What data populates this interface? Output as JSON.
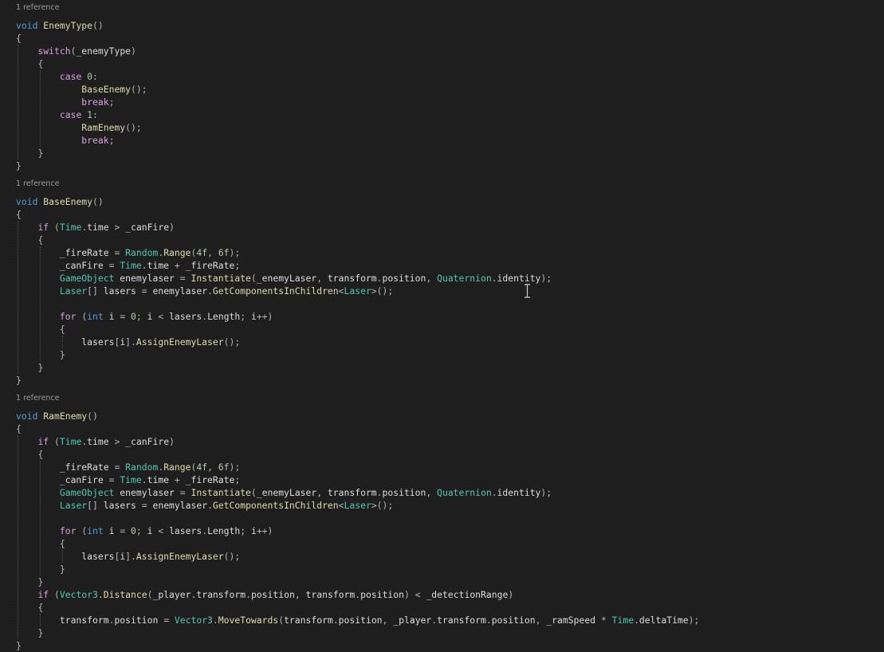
{
  "code_lens": [
    {
      "text": "1 reference",
      "line": 0
    },
    {
      "text": "1 reference",
      "line": 13
    },
    {
      "text": "1 reference",
      "line": 30
    }
  ],
  "lines": [
    [
      [
        "kw",
        "void"
      ],
      [
        "id",
        " "
      ],
      [
        "fn",
        "EnemyType"
      ],
      [
        "pn",
        "()"
      ]
    ],
    [
      [
        "pn",
        "{"
      ]
    ],
    [
      [
        "id",
        "    "
      ],
      [
        "ctl",
        "switch"
      ],
      [
        "pn",
        "("
      ],
      [
        "id",
        "_enemyType"
      ],
      [
        "pn",
        ")"
      ]
    ],
    [
      [
        "id",
        "    "
      ],
      [
        "pn",
        "{"
      ]
    ],
    [
      [
        "id",
        "        "
      ],
      [
        "ctl",
        "case"
      ],
      [
        "id",
        " "
      ],
      [
        "num",
        "0"
      ],
      [
        "pn",
        ":"
      ]
    ],
    [
      [
        "id",
        "            "
      ],
      [
        "fn",
        "BaseEnemy"
      ],
      [
        "pn",
        "();"
      ]
    ],
    [
      [
        "id",
        "            "
      ],
      [
        "ctl",
        "break"
      ],
      [
        "pn",
        ";"
      ]
    ],
    [
      [
        "id",
        "        "
      ],
      [
        "ctl",
        "case"
      ],
      [
        "id",
        " "
      ],
      [
        "num",
        "1"
      ],
      [
        "pn",
        ":"
      ]
    ],
    [
      [
        "id",
        "            "
      ],
      [
        "fn",
        "RamEnemy"
      ],
      [
        "pn",
        "();"
      ]
    ],
    [
      [
        "id",
        "            "
      ],
      [
        "ctl",
        "break"
      ],
      [
        "pn",
        ";"
      ]
    ],
    [
      [
        "id",
        "    "
      ],
      [
        "pn",
        "}"
      ]
    ],
    [
      [
        "pn",
        "}"
      ]
    ],
    [],
    [
      [
        "kw",
        "void"
      ],
      [
        "id",
        " "
      ],
      [
        "fn",
        "BaseEnemy"
      ],
      [
        "pn",
        "()"
      ]
    ],
    [
      [
        "pn",
        "{"
      ]
    ],
    [
      [
        "id",
        "    "
      ],
      [
        "ctl",
        "if"
      ],
      [
        "id",
        " "
      ],
      [
        "pn",
        "("
      ],
      [
        "ty",
        "Time"
      ],
      [
        "pn",
        "."
      ],
      [
        "id",
        "time "
      ],
      [
        "pn",
        "> "
      ],
      [
        "id",
        "_canFire"
      ],
      [
        "pn",
        ")"
      ]
    ],
    [
      [
        "id",
        "    "
      ],
      [
        "pn",
        "{"
      ]
    ],
    [
      [
        "id",
        "        _fireRate "
      ],
      [
        "pn",
        "= "
      ],
      [
        "ty",
        "Random"
      ],
      [
        "pn",
        "."
      ],
      [
        "fn",
        "Range"
      ],
      [
        "pn",
        "("
      ],
      [
        "num",
        "4f"
      ],
      [
        "pn",
        ", "
      ],
      [
        "num",
        "6f"
      ],
      [
        "pn",
        ");"
      ]
    ],
    [
      [
        "id",
        "        _canFire "
      ],
      [
        "pn",
        "= "
      ],
      [
        "ty",
        "Time"
      ],
      [
        "pn",
        "."
      ],
      [
        "id",
        "time "
      ],
      [
        "pn",
        "+ "
      ],
      [
        "id",
        "_fireRate"
      ],
      [
        "pn",
        ";"
      ]
    ],
    [
      [
        "id",
        "        "
      ],
      [
        "ty",
        "GameObject"
      ],
      [
        "id",
        " enemylaser "
      ],
      [
        "pn",
        "= "
      ],
      [
        "fn",
        "Instantiate"
      ],
      [
        "pn",
        "("
      ],
      [
        "id",
        "_enemyLaser"
      ],
      [
        "pn",
        ", "
      ],
      [
        "id",
        "transform"
      ],
      [
        "pn",
        "."
      ],
      [
        "id",
        "position"
      ],
      [
        "pn",
        ", "
      ],
      [
        "ty",
        "Quaternion"
      ],
      [
        "pn",
        "."
      ],
      [
        "id",
        "identity"
      ],
      [
        "pn",
        ");"
      ]
    ],
    [
      [
        "id",
        "        "
      ],
      [
        "ty",
        "Laser"
      ],
      [
        "pn",
        "[] "
      ],
      [
        "id",
        "lasers "
      ],
      [
        "pn",
        "= "
      ],
      [
        "id",
        "enemylaser"
      ],
      [
        "pn",
        "."
      ],
      [
        "fn",
        "GetComponentsInChildren"
      ],
      [
        "pn",
        "<"
      ],
      [
        "ty",
        "Laser"
      ],
      [
        "pn",
        ">();"
      ]
    ],
    [],
    [
      [
        "id",
        "        "
      ],
      [
        "ctl",
        "for"
      ],
      [
        "id",
        " "
      ],
      [
        "pn",
        "("
      ],
      [
        "kw",
        "int"
      ],
      [
        "id",
        " i "
      ],
      [
        "pn",
        "= "
      ],
      [
        "num",
        "0"
      ],
      [
        "pn",
        "; "
      ],
      [
        "id",
        "i "
      ],
      [
        "pn",
        "< "
      ],
      [
        "id",
        "lasers"
      ],
      [
        "pn",
        "."
      ],
      [
        "id",
        "Length"
      ],
      [
        "pn",
        "; "
      ],
      [
        "id",
        "i"
      ],
      [
        "pn",
        "++)"
      ]
    ],
    [
      [
        "id",
        "        "
      ],
      [
        "pn",
        "{"
      ]
    ],
    [
      [
        "id",
        "            lasers"
      ],
      [
        "pn",
        "["
      ],
      [
        "id",
        "i"
      ],
      [
        "pn",
        "]."
      ],
      [
        "fn",
        "AssignEnemyLaser"
      ],
      [
        "pn",
        "();"
      ]
    ],
    [
      [
        "id",
        "        "
      ],
      [
        "pn",
        "}"
      ]
    ],
    [
      [
        "id",
        "    "
      ],
      [
        "pn",
        "}"
      ]
    ],
    [
      [
        "pn",
        "}"
      ]
    ],
    [],
    [],
    [
      [
        "kw",
        "void"
      ],
      [
        "id",
        " "
      ],
      [
        "fn",
        "RamEnemy"
      ],
      [
        "pn",
        "()"
      ]
    ],
    [
      [
        "pn",
        "{"
      ]
    ],
    [
      [
        "id",
        "    "
      ],
      [
        "ctl",
        "if"
      ],
      [
        "id",
        " "
      ],
      [
        "pn",
        "("
      ],
      [
        "ty",
        "Time"
      ],
      [
        "pn",
        "."
      ],
      [
        "id",
        "time "
      ],
      [
        "pn",
        "> "
      ],
      [
        "id",
        "_canFire"
      ],
      [
        "pn",
        ")"
      ]
    ],
    [
      [
        "id",
        "    "
      ],
      [
        "pn",
        "{"
      ]
    ],
    [
      [
        "id",
        "        _fireRate "
      ],
      [
        "pn",
        "= "
      ],
      [
        "ty",
        "Random"
      ],
      [
        "pn",
        "."
      ],
      [
        "fn",
        "Range"
      ],
      [
        "pn",
        "("
      ],
      [
        "num",
        "4f"
      ],
      [
        "pn",
        ", "
      ],
      [
        "num",
        "6f"
      ],
      [
        "pn",
        ");"
      ]
    ],
    [
      [
        "id",
        "        _canFire "
      ],
      [
        "pn",
        "= "
      ],
      [
        "ty",
        "Time"
      ],
      [
        "pn",
        "."
      ],
      [
        "id",
        "time "
      ],
      [
        "pn",
        "+ "
      ],
      [
        "id",
        "_fireRate"
      ],
      [
        "pn",
        ";"
      ]
    ],
    [
      [
        "id",
        "        "
      ],
      [
        "ty",
        "GameObject"
      ],
      [
        "id",
        " enemylaser "
      ],
      [
        "pn",
        "= "
      ],
      [
        "fn",
        "Instantiate"
      ],
      [
        "pn",
        "("
      ],
      [
        "id",
        "_enemyLaser"
      ],
      [
        "pn",
        ", "
      ],
      [
        "id",
        "transform"
      ],
      [
        "pn",
        "."
      ],
      [
        "id",
        "position"
      ],
      [
        "pn",
        ", "
      ],
      [
        "ty",
        "Quaternion"
      ],
      [
        "pn",
        "."
      ],
      [
        "id",
        "identity"
      ],
      [
        "pn",
        ");"
      ]
    ],
    [
      [
        "id",
        "        "
      ],
      [
        "ty",
        "Laser"
      ],
      [
        "pn",
        "[] "
      ],
      [
        "id",
        "lasers "
      ],
      [
        "pn",
        "= "
      ],
      [
        "id",
        "enemylaser"
      ],
      [
        "pn",
        "."
      ],
      [
        "fn",
        "GetComponentsInChildren"
      ],
      [
        "pn",
        "<"
      ],
      [
        "ty",
        "Laser"
      ],
      [
        "pn",
        ">();"
      ]
    ],
    [],
    [
      [
        "id",
        "        "
      ],
      [
        "ctl",
        "for"
      ],
      [
        "id",
        " "
      ],
      [
        "pn",
        "("
      ],
      [
        "kw",
        "int"
      ],
      [
        "id",
        " i "
      ],
      [
        "pn",
        "= "
      ],
      [
        "num",
        "0"
      ],
      [
        "pn",
        "; "
      ],
      [
        "id",
        "i "
      ],
      [
        "pn",
        "< "
      ],
      [
        "id",
        "lasers"
      ],
      [
        "pn",
        "."
      ],
      [
        "id",
        "Length"
      ],
      [
        "pn",
        "; "
      ],
      [
        "id",
        "i"
      ],
      [
        "pn",
        "++)"
      ]
    ],
    [
      [
        "id",
        "        "
      ],
      [
        "pn",
        "{"
      ]
    ],
    [
      [
        "id",
        "            lasers"
      ],
      [
        "pn",
        "["
      ],
      [
        "id",
        "i"
      ],
      [
        "pn",
        "]."
      ],
      [
        "fn",
        "AssignEnemyLaser"
      ],
      [
        "pn",
        "();"
      ]
    ],
    [
      [
        "id",
        "        "
      ],
      [
        "pn",
        "}"
      ]
    ],
    [
      [
        "id",
        "    "
      ],
      [
        "pn",
        "}"
      ]
    ],
    [
      [
        "id",
        "    "
      ],
      [
        "ctl",
        "if"
      ],
      [
        "id",
        " "
      ],
      [
        "pn",
        "("
      ],
      [
        "ty",
        "Vector3"
      ],
      [
        "pn",
        "."
      ],
      [
        "fn",
        "Distance"
      ],
      [
        "pn",
        "("
      ],
      [
        "id",
        "_player"
      ],
      [
        "pn",
        "."
      ],
      [
        "id",
        "transform"
      ],
      [
        "pn",
        "."
      ],
      [
        "id",
        "position"
      ],
      [
        "pn",
        ", "
      ],
      [
        "id",
        "transform"
      ],
      [
        "pn",
        "."
      ],
      [
        "id",
        "position"
      ],
      [
        "pn",
        ") < "
      ],
      [
        "id",
        "_detectionRange"
      ],
      [
        "pn",
        ")"
      ]
    ],
    [
      [
        "id",
        "    "
      ],
      [
        "pn",
        "{"
      ]
    ],
    [
      [
        "id",
        "        transform"
      ],
      [
        "pn",
        "."
      ],
      [
        "id",
        "position "
      ],
      [
        "pn",
        "= "
      ],
      [
        "ty",
        "Vector3"
      ],
      [
        "pn",
        "."
      ],
      [
        "fn",
        "MoveTowards"
      ],
      [
        "pn",
        "("
      ],
      [
        "id",
        "transform"
      ],
      [
        "pn",
        "."
      ],
      [
        "id",
        "position"
      ],
      [
        "pn",
        ", "
      ],
      [
        "id",
        "_player"
      ],
      [
        "pn",
        "."
      ],
      [
        "id",
        "transform"
      ],
      [
        "pn",
        "."
      ],
      [
        "id",
        "position"
      ],
      [
        "pn",
        ", "
      ],
      [
        "id",
        "_ramSpeed "
      ],
      [
        "pn",
        "* "
      ],
      [
        "ty",
        "Time"
      ],
      [
        "pn",
        "."
      ],
      [
        "id",
        "deltaTime"
      ],
      [
        "pn",
        ");"
      ]
    ],
    [
      [
        "id",
        "    "
      ],
      [
        "pn",
        "}"
      ]
    ],
    [
      [
        "pn",
        "}"
      ]
    ]
  ]
}
